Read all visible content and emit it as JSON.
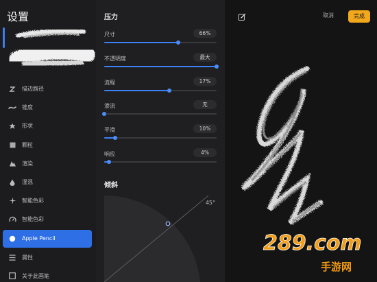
{
  "sidebar": {
    "title": "设置",
    "items": [
      {
        "label": "描边路径",
        "icon": "stroke-path-icon"
      },
      {
        "label": "锥度",
        "icon": "taper-icon"
      },
      {
        "label": "形状",
        "icon": "shape-icon"
      },
      {
        "label": "颗粒",
        "icon": "grain-icon"
      },
      {
        "label": "渲染",
        "icon": "render-icon"
      },
      {
        "label": "湿混",
        "icon": "wet-mix-icon"
      },
      {
        "label": "智能色彩",
        "icon": "color-dynamics-icon"
      },
      {
        "label": "智能色彩",
        "icon": "dynamics-icon"
      },
      {
        "label": "Apple Pencil",
        "icon": "pencil-icon",
        "active": true
      },
      {
        "label": "属性",
        "icon": "properties-icon"
      },
      {
        "label": "关于此画笔",
        "icon": "about-icon"
      }
    ]
  },
  "panel": {
    "pressure_title": "压力",
    "settings": [
      {
        "key": "size",
        "label": "尺寸",
        "value": "66%",
        "level": 0.66
      },
      {
        "key": "opacity",
        "label": "不透明度",
        "value": "最大",
        "level": 1.0
      },
      {
        "key": "flow",
        "label": "流程",
        "value": "17%",
        "level": 0.58
      },
      {
        "key": "bleed",
        "label": "渗流",
        "value": "无",
        "level": 0.0
      },
      {
        "key": "smoothing",
        "label": "平滑",
        "value": "10%",
        "level": 0.1
      },
      {
        "key": "response",
        "label": "响应",
        "value": "4%",
        "level": 0.04
      }
    ],
    "tilt_title": "倾斜",
    "tilt_angle": "45°"
  },
  "canvas": {
    "cancel_label": "取消",
    "done_label": "完成",
    "accent": "#f2a81d"
  },
  "watermark": {
    "logo_text": "289.com",
    "caption": "手游网"
  }
}
